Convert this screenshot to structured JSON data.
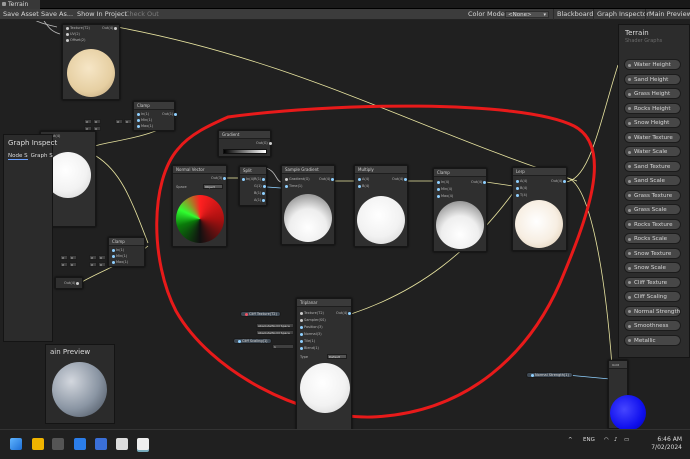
{
  "window": {
    "tab_title": "Terrain"
  },
  "toolbar": {
    "save_asset": "Save Asset",
    "save_as": "Save As...",
    "show_in_project": "Show In Project",
    "check_out": "Check Out",
    "color_mode_label": "Color Mode",
    "color_mode_value": "<None>",
    "blackboard": "Blackboard",
    "graph_inspector": "Graph Inspector",
    "main_preview": "Main Preview"
  },
  "blackboard": {
    "title": "Terrain",
    "subtitle": "Shader Graphs",
    "properties": [
      {
        "label": "Water Height"
      },
      {
        "label": "Sand Height"
      },
      {
        "label": "Grass Height"
      },
      {
        "label": "Rocks Height"
      },
      {
        "label": "Snow Height"
      },
      {
        "label": "Water Texture",
        "type": "T"
      },
      {
        "label": "Water Scale"
      },
      {
        "label": "Sand Texture",
        "type": "T"
      },
      {
        "label": "Sand Scale"
      },
      {
        "label": "Grass Texture",
        "type": "T"
      },
      {
        "label": "Grass Scale"
      },
      {
        "label": "Rocks Texture",
        "type": "T"
      },
      {
        "label": "Rocks Scale"
      },
      {
        "label": "Snow Texture",
        "type": "T"
      },
      {
        "label": "Snow Scale"
      },
      {
        "label": "Cliff Texture",
        "type": "T"
      },
      {
        "label": "Cliff Scaling"
      },
      {
        "label": "Normal Strength"
      },
      {
        "label": "Smoothness"
      },
      {
        "label": "Metallic"
      }
    ]
  },
  "graph_inspector": {
    "title": "Graph Inspect",
    "tab_node": "Node S",
    "tab_graph": "Graph S"
  },
  "main_preview": {
    "title": "ain Preview"
  },
  "nodes": {
    "top_tex": {
      "in1": "Texture(T2)",
      "in2": "UV(2)",
      "in3": "Offset(2)",
      "out": "Out(4)"
    },
    "clamp_top": {
      "title": "Clamp",
      "in1": "In(1)",
      "in2": "Min(1)",
      "in3": "Max(1)",
      "out": "Out(1)",
      "v_x": "X",
      "v0": "0"
    },
    "clamp_left": {
      "title": "Clamp",
      "in1": "In(1)",
      "in2": "Min(1)",
      "in3": "Max(1)",
      "out": "Out(1)",
      "v_x": "X",
      "v0": "0"
    },
    "left_preview": {
      "in": "Out(4)"
    },
    "left_out": {
      "out": "Out(4)"
    },
    "gradient": {
      "title": "Gradient",
      "out": "Out(G)"
    },
    "normal_vector": {
      "title": "Normal Vector",
      "space_label": "Space",
      "space_value": "Object",
      "out": "Out(3)"
    },
    "split": {
      "title": "Split",
      "in": "In(4)",
      "r": "R(1)",
      "g": "G(1)",
      "b": "B(1)",
      "a": "A(1)"
    },
    "sample_gradient": {
      "title": "Sample Gradient",
      "in1": "Gradient(G)",
      "in2": "Time(1)",
      "out": "Out(4)"
    },
    "multiply": {
      "title": "Multiply",
      "in1": "A(4)",
      "in2": "B(4)",
      "out": "Out(4)"
    },
    "clamp_mid": {
      "title": "Clamp",
      "in1": "In(4)",
      "in2": "Min(4)",
      "in3": "Max(4)",
      "out": "Out(4)"
    },
    "lerp": {
      "title": "Lerp",
      "in1": "A(4)",
      "in2": "B(4)",
      "in3": "T(4)",
      "out": "Out(4)"
    },
    "triplanar": {
      "title": "Triplanar",
      "in1": "Texture(T2)",
      "in2": "Sampler(SS)",
      "in3": "Position(3)",
      "in4": "Normal(3)",
      "in5": "Tile(1)",
      "in6": "Blend(1)",
      "type_label": "Type",
      "type_value": "Default",
      "out": "Out(4)",
      "pos_value": "AbsoluteWorld Space",
      "normal_value": "AbsoluteWorld Space",
      "blend_value": "1"
    },
    "cliff_texture_chip": {
      "label": "Cliff Texture(T2)"
    },
    "cliff_scaling_chip": {
      "label": "Cliff Scaling(1)"
    },
    "normal_strength_chip": {
      "label": "Normal Strength(1)"
    },
    "master": {
      "title": "Unlit"
    }
  },
  "taskbar": {
    "lang": "ENG",
    "time": "6:46 AM",
    "date": "7/02/2024"
  },
  "colors": {
    "accent_wire_yellow": "#e8e4a0",
    "annotation_red": "#e81a1a",
    "port_blue": "#8fd0ff"
  }
}
